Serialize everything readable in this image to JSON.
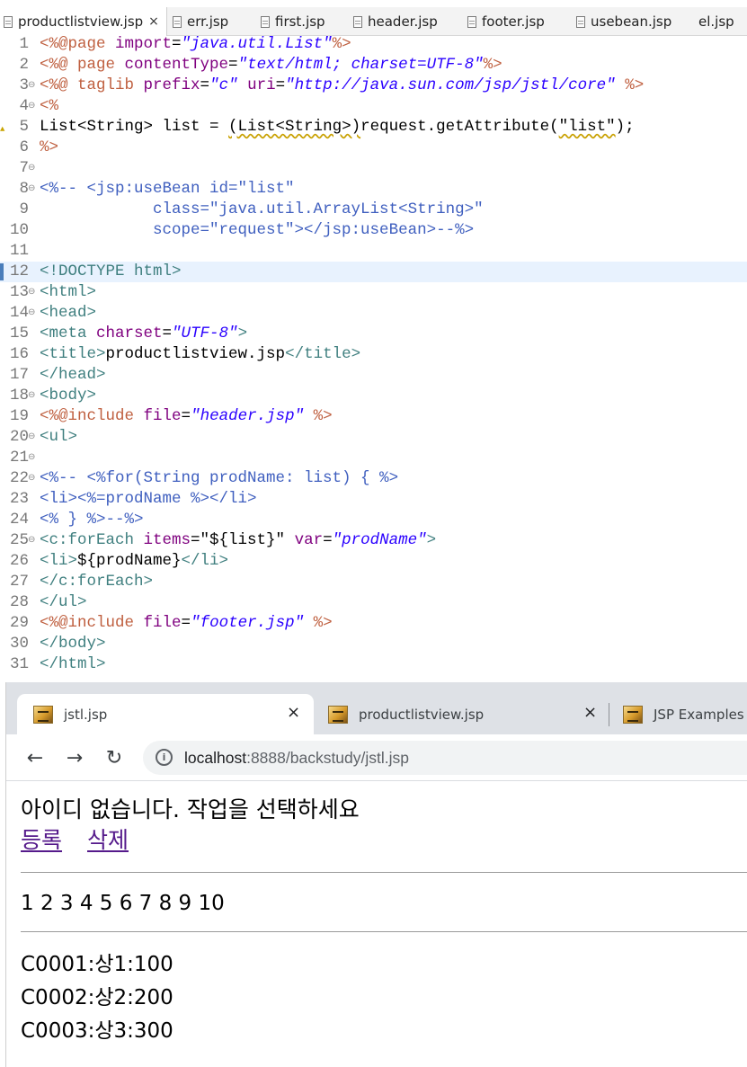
{
  "editor": {
    "tabs": [
      {
        "label": "productlistview.jsp",
        "close": "×",
        "active": true
      },
      {
        "label": "err.jsp"
      },
      {
        "label": "first.jsp"
      },
      {
        "label": "header.jsp"
      },
      {
        "label": "footer.jsp"
      },
      {
        "label": "usebean.jsp"
      },
      {
        "label": "el.jsp"
      }
    ],
    "fold_glyph": "⊖",
    "warning_glyph": "▲",
    "lines": [
      {
        "n": "1",
        "segs": [
          {
            "c": "jsp",
            "t": "<%@page "
          },
          {
            "c": "attr",
            "t": "import"
          },
          {
            "c": "plain",
            "t": "="
          },
          {
            "c": "val",
            "t": "\"java.util.List\""
          },
          {
            "c": "jsp",
            "t": "%>"
          }
        ]
      },
      {
        "n": "2",
        "segs": [
          {
            "c": "jsp",
            "t": "<%@ page "
          },
          {
            "c": "attr",
            "t": "contentType"
          },
          {
            "c": "plain",
            "t": "="
          },
          {
            "c": "val",
            "t": "\"text/html; charset=UTF-8\""
          },
          {
            "c": "jsp",
            "t": "%>"
          }
        ]
      },
      {
        "n": "3",
        "segs": [
          {
            "c": "jsp",
            "t": "<%@ taglib "
          },
          {
            "c": "attr",
            "t": "prefix"
          },
          {
            "c": "plain",
            "t": "="
          },
          {
            "c": "val",
            "t": "\"c\""
          },
          {
            "c": "plain",
            "t": " "
          },
          {
            "c": "attr",
            "t": "uri"
          },
          {
            "c": "plain",
            "t": "="
          },
          {
            "c": "val",
            "t": "\"http://java.sun.com/jsp/jstl/core\""
          },
          {
            "c": "plain",
            "t": " "
          },
          {
            "c": "jsp",
            "t": "%>"
          }
        ]
      },
      {
        "n": "4",
        "segs": [
          {
            "c": "jsp",
            "t": "<%"
          }
        ]
      },
      {
        "n": "5",
        "segs": [
          {
            "c": "plain",
            "t": "List<String> list = "
          },
          {
            "c": "plain sq",
            "t": "(List<String>)"
          },
          {
            "c": "plain",
            "t": "request.getAttribute("
          },
          {
            "c": "plain sq",
            "t": "\"list\""
          },
          {
            "c": "plain",
            "t": ");"
          }
        ]
      },
      {
        "n": "6",
        "segs": [
          {
            "c": "jsp",
            "t": "%>"
          }
        ]
      },
      {
        "n": "7",
        "segs": []
      },
      {
        "n": "8",
        "segs": [
          {
            "c": "cmt",
            "t": "<%-- <jsp:useBean id=\"list\""
          }
        ]
      },
      {
        "n": "9",
        "segs": [
          {
            "c": "cmt",
            "t": "            class=\"java.util.ArrayList<String>\""
          }
        ]
      },
      {
        "n": "10",
        "segs": [
          {
            "c": "cmt",
            "t": "            scope=\"request\"></jsp:useBean>--%>"
          }
        ]
      },
      {
        "n": "11",
        "segs": []
      },
      {
        "n": "12",
        "segs": [
          {
            "c": "tag",
            "t": "<!DOCTYPE html>"
          }
        ]
      },
      {
        "n": "13",
        "segs": [
          {
            "c": "tag",
            "t": "<html>"
          }
        ]
      },
      {
        "n": "14",
        "segs": [
          {
            "c": "tag",
            "t": "<head>"
          }
        ]
      },
      {
        "n": "15",
        "segs": [
          {
            "c": "tag",
            "t": "<meta "
          },
          {
            "c": "attr",
            "t": "charset"
          },
          {
            "c": "plain",
            "t": "="
          },
          {
            "c": "val",
            "t": "\"UTF-8\""
          },
          {
            "c": "tag",
            "t": ">"
          }
        ]
      },
      {
        "n": "16",
        "segs": [
          {
            "c": "tag",
            "t": "<title>"
          },
          {
            "c": "plain",
            "t": "productlistview.jsp"
          },
          {
            "c": "tag",
            "t": "</title>"
          }
        ]
      },
      {
        "n": "17",
        "segs": [
          {
            "c": "tag",
            "t": "</head>"
          }
        ]
      },
      {
        "n": "18",
        "segs": [
          {
            "c": "tag",
            "t": "<body>"
          }
        ]
      },
      {
        "n": "19",
        "segs": [
          {
            "c": "jsp",
            "t": "<%@include "
          },
          {
            "c": "attr",
            "t": "file"
          },
          {
            "c": "plain",
            "t": "="
          },
          {
            "c": "val",
            "t": "\"header.jsp\""
          },
          {
            "c": "plain",
            "t": " "
          },
          {
            "c": "jsp",
            "t": "%>"
          }
        ]
      },
      {
        "n": "20",
        "segs": [
          {
            "c": "tag",
            "t": "<ul>"
          }
        ]
      },
      {
        "n": "21",
        "segs": []
      },
      {
        "n": "22",
        "segs": [
          {
            "c": "cmt",
            "t": "<%-- <%for(String prodName: list) { %>"
          }
        ]
      },
      {
        "n": "23",
        "segs": [
          {
            "c": "cmt",
            "t": "<li><%=prodName %></li>"
          }
        ]
      },
      {
        "n": "24",
        "segs": [
          {
            "c": "cmt",
            "t": "<% } %>--%>"
          }
        ]
      },
      {
        "n": "25",
        "segs": [
          {
            "c": "tag",
            "t": "<c:forEach "
          },
          {
            "c": "attr",
            "t": "items"
          },
          {
            "c": "plain",
            "t": "=\"${list}\" "
          },
          {
            "c": "attr",
            "t": "var"
          },
          {
            "c": "plain",
            "t": "="
          },
          {
            "c": "val",
            "t": "\"prodName\""
          },
          {
            "c": "tag",
            "t": ">"
          }
        ]
      },
      {
        "n": "26",
        "segs": [
          {
            "c": "tag",
            "t": "<li>"
          },
          {
            "c": "plain",
            "t": "${prodName}"
          },
          {
            "c": "tag",
            "t": "</li>"
          }
        ]
      },
      {
        "n": "27",
        "segs": [
          {
            "c": "tag",
            "t": "</c:forEach>"
          }
        ]
      },
      {
        "n": "28",
        "segs": [
          {
            "c": "tag",
            "t": "</ul>"
          }
        ]
      },
      {
        "n": "29",
        "segs": [
          {
            "c": "jsp",
            "t": "<%@include "
          },
          {
            "c": "attr",
            "t": "file"
          },
          {
            "c": "plain",
            "t": "="
          },
          {
            "c": "val",
            "t": "\"footer.jsp\""
          },
          {
            "c": "plain",
            "t": " "
          },
          {
            "c": "jsp",
            "t": "%>"
          }
        ]
      },
      {
        "n": "30",
        "segs": [
          {
            "c": "tag",
            "t": "</body>"
          }
        ]
      },
      {
        "n": "31",
        "segs": [
          {
            "c": "tag",
            "t": "</html>"
          }
        ]
      }
    ]
  },
  "browser": {
    "tabs": [
      {
        "label": "jstl.jsp",
        "close": "×",
        "active": true
      },
      {
        "label": "productlistview.jsp",
        "close": "×"
      },
      {
        "label": "JSP Examples"
      }
    ],
    "nav": {
      "back": "←",
      "forward": "→",
      "reload": "↻"
    },
    "address": {
      "info": "i",
      "host": "localhost",
      "rest": ":8888/backstudy/jstl.jsp"
    },
    "page": {
      "message": "아이디 없습니다. 작업을 선택하세요",
      "link_register": "등록",
      "link_delete": "삭제",
      "numbers": "1 2 3 4 5 6 7 8 9 10",
      "products": [
        "C0001:상1:100",
        "C0002:상2:200",
        "C0003:상3:300"
      ]
    }
  }
}
